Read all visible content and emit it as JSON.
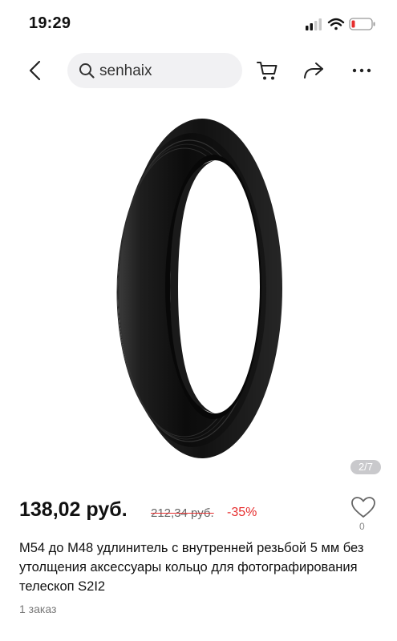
{
  "status_bar": {
    "time": "19:29"
  },
  "nav": {
    "search_query": "senhaix"
  },
  "gallery": {
    "indicator": "2/7"
  },
  "product": {
    "price": "138,02 руб.",
    "old_price": "212,34 руб.",
    "discount": "-35%",
    "wishlist_count": "0",
    "title": "M54 до M48 удлинитель с внутренней резьбой 5 мм без утолщения аксессуары кольцо для фотографирования телескоп S2I2",
    "orders": "1 заказ"
  },
  "colors": {
    "accent_red": "#e62e2e",
    "search_bg": "#f1f1f3",
    "indicator_bg": "#c9c9cc"
  }
}
